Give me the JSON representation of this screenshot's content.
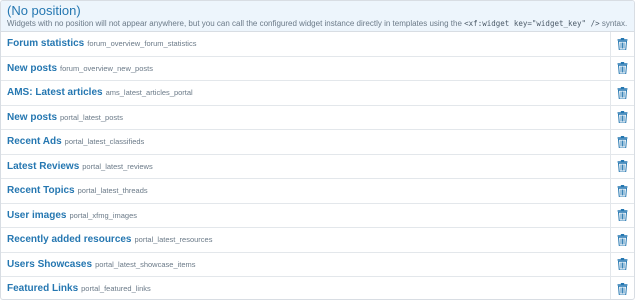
{
  "section": {
    "title": "(No position)",
    "description_before": "Widgets with no position will not appear anywhere, but you can call the configured widget instance directly in templates using the",
    "description_code": "<xf:widget key=\"widget_key\" />",
    "description_after": "syntax."
  },
  "widgets": [
    {
      "title": "Forum statistics",
      "key": "forum_overview_forum_statistics"
    },
    {
      "title": "New posts",
      "key": "forum_overview_new_posts"
    },
    {
      "title": "AMS: Latest articles",
      "key": "ams_latest_articles_portal"
    },
    {
      "title": "New posts",
      "key": "portal_latest_posts"
    },
    {
      "title": "Recent Ads",
      "key": "portal_latest_classifieds"
    },
    {
      "title": "Latest Reviews",
      "key": "portal_latest_reviews"
    },
    {
      "title": "Recent Topics",
      "key": "portal_latest_threads"
    },
    {
      "title": "User images",
      "key": "portal_xfmg_images"
    },
    {
      "title": "Recently added resources",
      "key": "portal_latest_resources"
    },
    {
      "title": "Users Showcases",
      "key": "portal_latest_showcase_items"
    },
    {
      "title": "Featured Links",
      "key": "portal_featured_links"
    }
  ],
  "colors": {
    "accent": "#2577b1",
    "header_bg": "#edf5fc",
    "muted": "#6b7a88"
  },
  "icons": {
    "delete": "trash-icon"
  }
}
